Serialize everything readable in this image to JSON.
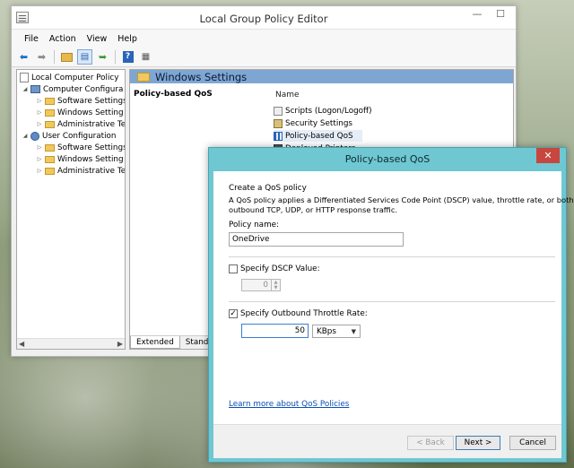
{
  "main_window": {
    "title": "Local Group Policy Editor",
    "menu": [
      "File",
      "Action",
      "View",
      "Help"
    ],
    "toolbar_icons": [
      "back-arrow-icon",
      "forward-arrow-icon",
      "up-folder-icon",
      "show-hide-tree-icon",
      "export-list-icon",
      "help-icon",
      "properties-icon"
    ],
    "tree": {
      "items": [
        {
          "label": "Local Computer Policy",
          "icon": "policy-doc-icon"
        },
        {
          "label": "Computer Configura",
          "icon": "computer-icon"
        },
        {
          "label": "Software Settings",
          "icon": "folder-icon"
        },
        {
          "label": "Windows Setting",
          "icon": "folder-icon"
        },
        {
          "label": "Administrative Te",
          "icon": "folder-icon"
        },
        {
          "label": "User Configuration",
          "icon": "user-icon"
        },
        {
          "label": "Software Settings",
          "icon": "folder-icon"
        },
        {
          "label": "Windows Setting",
          "icon": "folder-icon"
        },
        {
          "label": "Administrative Te",
          "icon": "folder-icon"
        }
      ]
    },
    "details": {
      "header": "Windows Settings",
      "left_title": "Policy-based QoS",
      "column_name": "Name",
      "items": [
        {
          "label": "Scripts (Logon/Logoff)",
          "icon": "script-icon"
        },
        {
          "label": "Security Settings",
          "icon": "security-icon"
        },
        {
          "label": "Policy-based QoS",
          "icon": "qos-bars-icon"
        },
        {
          "label": "Deployed Printers",
          "icon": "printer-icon"
        }
      ],
      "tabs": [
        "Extended",
        "Standard"
      ]
    }
  },
  "dialog": {
    "title": "Policy-based QoS",
    "close_glyph": "✕",
    "heading": "Create a QoS policy",
    "description_line1": "A QoS policy applies a Differentiated Services Code Point (DSCP) value, throttle rate, or both to",
    "description_line2": "outbound TCP, UDP, or HTTP response traffic.",
    "policy_name_label": "Policy name:",
    "policy_name_value": "OneDrive",
    "dscp_label": "Specify DSCP Value:",
    "dscp_checked": false,
    "dscp_value": "0",
    "throttle_label": "Specify Outbound Throttle Rate:",
    "throttle_checked": true,
    "throttle_value": "50",
    "throttle_unit": "KBps",
    "learn_more_link": "Learn more about QoS Policies",
    "buttons": {
      "back": "< Back",
      "next": "Next >",
      "cancel": "Cancel"
    }
  }
}
